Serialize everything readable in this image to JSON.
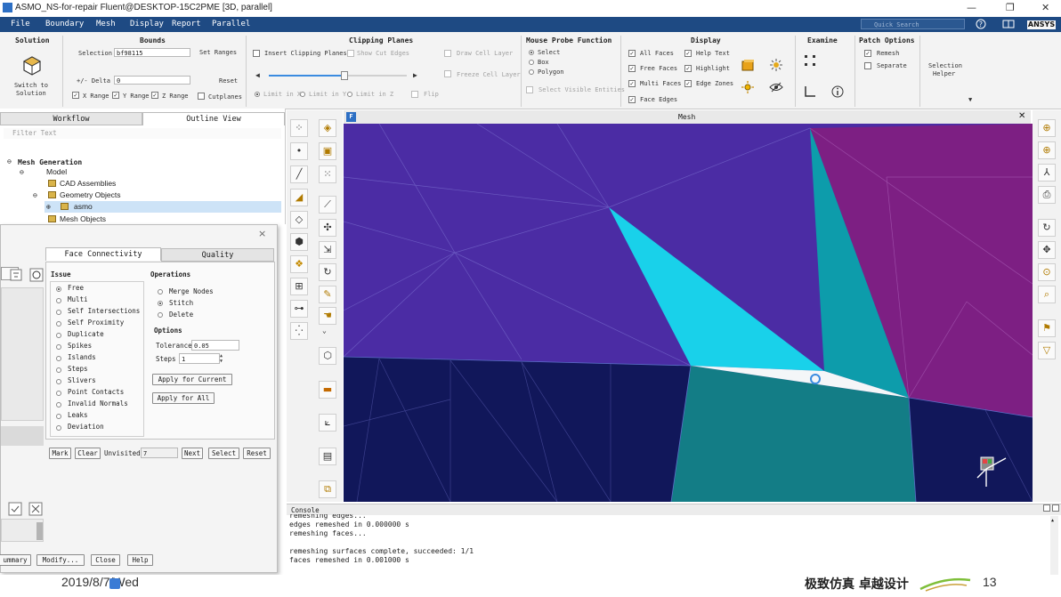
{
  "window": {
    "title": "ASMO_NS-for-repair Fluent@DESKTOP-15C2PME  [3D, parallel]",
    "minimize": "—",
    "restore": "❐",
    "close": "✕"
  },
  "menubar": {
    "items": [
      "File",
      "Boundary",
      "Mesh",
      "Display",
      "Report",
      "Parallel"
    ],
    "search_placeholder": "Quick Search",
    "brand": "ANSYS"
  },
  "ribbon": {
    "solution": {
      "header": "Solution",
      "switch_label_1": "Switch to",
      "switch_label_2": "Solution"
    },
    "bounds": {
      "header": "Bounds",
      "selection_label": "Selection",
      "selection_value": "bf98115",
      "set_ranges": "Set Ranges",
      "delta_label": "+/- Delta",
      "delta_value": "0",
      "reset": "Reset",
      "x_range": "X Range",
      "y_range": "Y Range",
      "z_range": "Z Range",
      "cutplanes": "Cutplanes"
    },
    "clipping": {
      "header": "Clipping Planes",
      "insert": "Insert Clipping Planes",
      "show_cut_edges": "Show Cut Edges",
      "draw_cell_layer": "Draw Cell Layer",
      "freeze_cell_layer": "Freeze Cell Layer",
      "limit_x": "Limit in X",
      "limit_y": "Limit in Y",
      "limit_z": "Limit in Z",
      "flip": "Flip",
      "slider_level": 0.55
    },
    "probe": {
      "header": "Mouse Probe Function",
      "select": "Select",
      "box": "Box",
      "polygon": "Polygon",
      "select_visible": "Select Visible Entities"
    },
    "display": {
      "header": "Display",
      "all_faces": "All Faces",
      "free_faces": "Free Faces",
      "multi_faces": "Multi Faces",
      "face_edges": "Face Edges",
      "help_text": "Help Text",
      "highlight": "Highlight",
      "edge_zones": "Edge Zones"
    },
    "examine": {
      "header": "Examine"
    },
    "patch": {
      "header": "Patch Options",
      "remesh": "Remesh",
      "separate": "Separate"
    },
    "selection_helper": {
      "line1": "Selection",
      "line2": "Helper"
    }
  },
  "leftpanel": {
    "tabs": [
      "Workflow",
      "Outline View"
    ],
    "filter_placeholder": "Filter Text",
    "tree": {
      "root": "Mesh Generation",
      "model": "Model",
      "cad": "CAD Assemblies",
      "geometry": "Geometry Objects",
      "asmo": "asmo",
      "mesh_objects": "Mesh Objects"
    }
  },
  "dialog": {
    "close": "×",
    "tabs": [
      "Face Connectivity",
      "Quality"
    ],
    "issue_header": "Issue",
    "issues": [
      "Free",
      "Multi",
      "Self Intersections",
      "Self Proximity",
      "Duplicate",
      "Spikes",
      "Islands",
      "Steps",
      "Slivers",
      "Point Contacts",
      "Invalid Normals",
      "Leaks",
      "Deviation"
    ],
    "operations_header": "Operations",
    "operations": [
      "Merge Nodes",
      "Stitch",
      "Delete"
    ],
    "options_header": "Options",
    "tolerance_label": "Tolerance",
    "tolerance_value": "0.05",
    "steps_label": "Steps",
    "steps_value": "1",
    "apply_current": "Apply for Current",
    "apply_all": "Apply for All",
    "mark": "Mark",
    "clear": "Clear",
    "unvisited_label": "Unvisited",
    "unvisited_value": "7",
    "next": "Next",
    "select": "Select",
    "reset": "Reset",
    "summary": "ummary",
    "modify": "Modify...",
    "close_btn": "Close",
    "help": "Help"
  },
  "mesh": {
    "title": "Mesh",
    "close": "✕",
    "colors": {
      "purple": "#4b2ca4",
      "magenta": "#7d1f83",
      "cyan": "#19d1ea",
      "teal": "#0d9cab",
      "darkteal": "#137d86",
      "navy": "#11175a",
      "white": "#f4f6f8"
    }
  },
  "console": {
    "title": "Console",
    "lines": [
      "remeshing edges...",
      "edges remeshed in 0.000000 s",
      "remeshing faces...",
      "",
      "remeshing surfaces complete, succeeded: 1/1",
      "faces remeshed in 0.001000 s"
    ]
  },
  "bottom": {
    "date": "2019/8/7/Wed",
    "slogan": "极致仿真 卓越设计",
    "page": "13"
  }
}
